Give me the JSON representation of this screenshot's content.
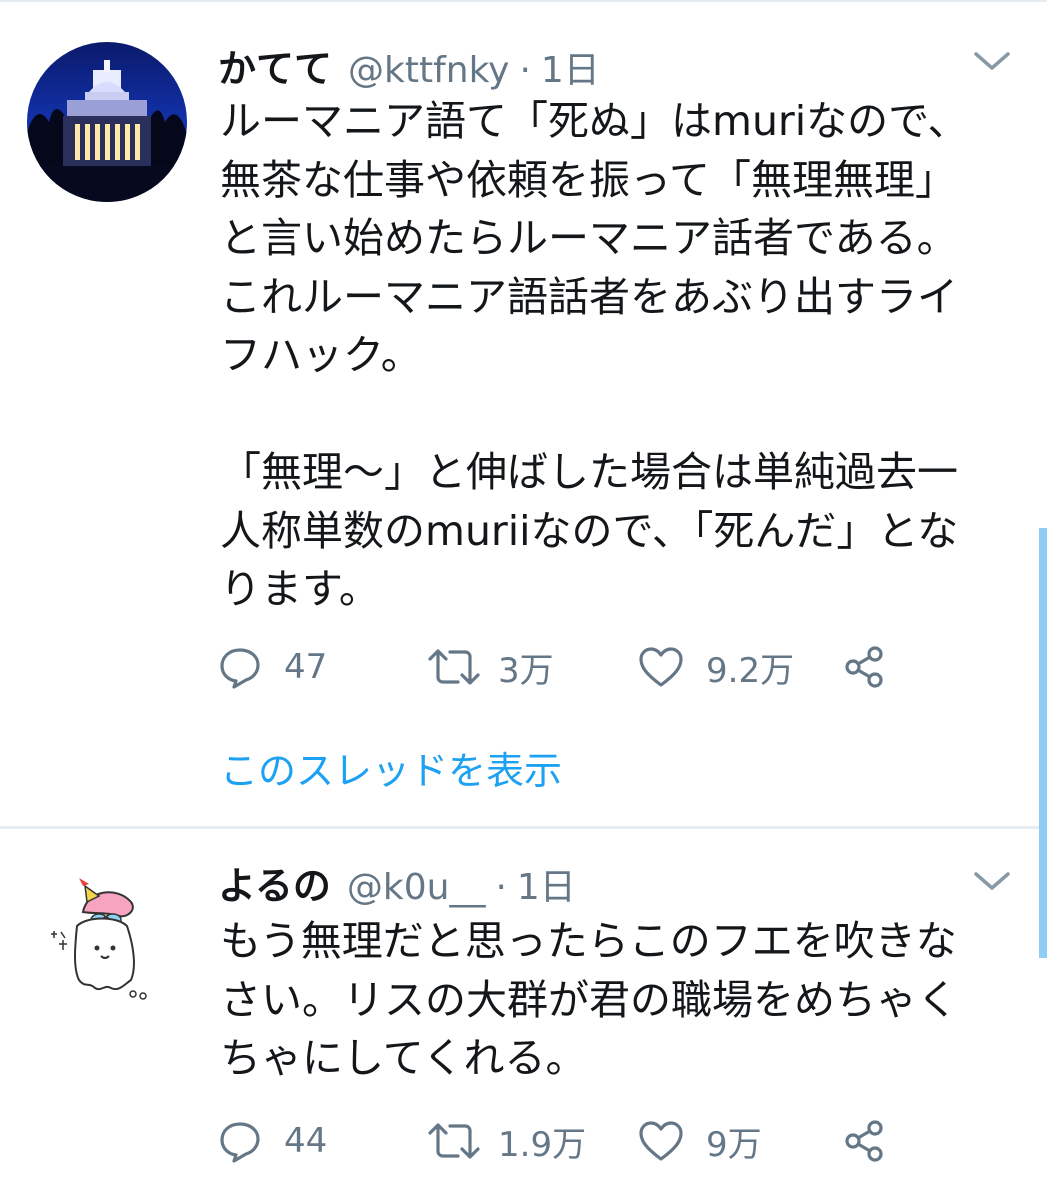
{
  "tweets": [
    {
      "display_name": "かてて",
      "handle": "@kttfnky",
      "separator": "·",
      "time": "1日",
      "avatar_icon": "capitol-building-night-photo",
      "lines": [
        "ルーマニア語て「死ぬ」はmuriなので、",
        "無茶な仕事や依頼を振って「無理無理」",
        "と言い始めたらルーマニア話者である。",
        "これルーマニア語話者をあぶり出すライ",
        "フハック。",
        "",
        "「無理～」と伸ばした場合は単純過去一",
        "人称単数のmuriiなので、「死んだ」とな",
        "ります。"
      ],
      "reply_count": "47",
      "retweet_count": "3万",
      "like_count": "9.2万",
      "thread_link": "このスレッドを表示"
    },
    {
      "display_name": "よるの",
      "handle": "@k0u__",
      "separator": "·",
      "time": "1日",
      "avatar_icon": "ghost-with-bow-illustration",
      "lines": [
        "もう無理だと思ったらこのフエを吹きな",
        "さい。リスの大群が君の職場をめちゃく",
        "ちゃにしてくれる。"
      ],
      "reply_count": "44",
      "retweet_count": "1.9万",
      "like_count": "9万"
    }
  ],
  "colors": {
    "text": "#14171a",
    "secondary": "#657786",
    "link": "#1da1f2",
    "divider": "#e6ecf0",
    "scrollbar": "#8ecdf5"
  },
  "icons": [
    "reply-icon",
    "retweet-icon",
    "like-icon",
    "share-icon",
    "chevron-down-icon"
  ]
}
